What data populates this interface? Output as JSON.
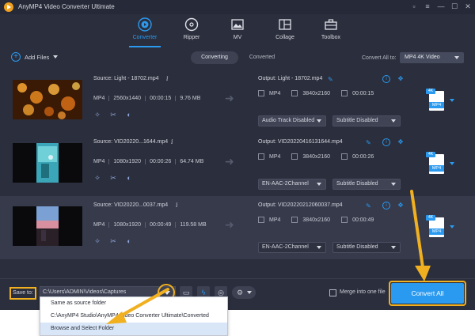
{
  "window": {
    "title": "AnyMP4 Video Converter Ultimate",
    "controls": [
      "▫",
      "≡",
      "—",
      "☐",
      "✕"
    ]
  },
  "nav": {
    "items": [
      {
        "label": "Converter",
        "icon": "converter-icon",
        "active": true
      },
      {
        "label": "Ripper",
        "icon": "ripper-disc-icon",
        "active": false
      },
      {
        "label": "MV",
        "icon": "mv-image-icon",
        "active": false
      },
      {
        "label": "Collage",
        "icon": "collage-grid-icon",
        "active": false
      },
      {
        "label": "Toolbox",
        "icon": "toolbox-icon",
        "active": false
      }
    ],
    "active_color": "#2a9af0"
  },
  "toolbar": {
    "add_files": "Add Files",
    "tab_converting": "Converting",
    "tab_converted": "Converted",
    "convert_all_to": "Convert All to:",
    "format_value": "MP4 4K Video"
  },
  "files": [
    {
      "source": "Source: Light - 18702.mp4",
      "format": "MP4",
      "resolution": "2560x1440",
      "duration": "00:00:15",
      "size": "9.76 MB",
      "output": "Output: Light - 18702.mp4",
      "out_format": "MP4",
      "out_resolution": "3840x2160",
      "out_duration": "00:00:15",
      "audio": "Audio Track Disabled",
      "subtitle": "Subtitle Disabled",
      "badge_top": "4K",
      "badge_format": "MP4"
    },
    {
      "source": "Source: VID20220...1644.mp4",
      "format": "MP4",
      "resolution": "1080x1920",
      "duration": "00:00:26",
      "size": "64.74 MB",
      "output": "Output: VID20220416131644.mp4",
      "out_format": "MP4",
      "out_resolution": "3840x2160",
      "out_duration": "00:00:26",
      "audio": "EN-AAC-2Channel",
      "subtitle": "Subtitle Disabled",
      "badge_top": "4K",
      "badge_format": "MP4"
    },
    {
      "source": "Source: VID20220...0037.mp4",
      "format": "MP4",
      "resolution": "1080x1920",
      "duration": "00:00:49",
      "size": "119.58 MB",
      "output": "Output: VID20220212060037.mp4",
      "out_format": "MP4",
      "out_resolution": "3840x2160",
      "out_duration": "00:00:49",
      "audio": "EN-AAC-2Channel",
      "subtitle": "Subtitle Disabled",
      "badge_top": "4K",
      "badge_format": "MP4"
    }
  ],
  "bottom": {
    "save_to": "Save to:",
    "path": "C:\\Users\\ADMIN\\Videos\\Captures",
    "merge_label": "Merge into one file",
    "merge_checked": false,
    "convert_all": "Convert All"
  },
  "path_menu": {
    "items": [
      "Same as source folder",
      "C:\\AnyMP4 Studio\\AnyMP4 Video Converter Ultimate\\Converted",
      "Browse and Select Folder"
    ],
    "selected_index": 2
  },
  "colors": {
    "accent": "#2a9af0",
    "highlight": "#f0b020",
    "background": "#2b2e3c"
  }
}
